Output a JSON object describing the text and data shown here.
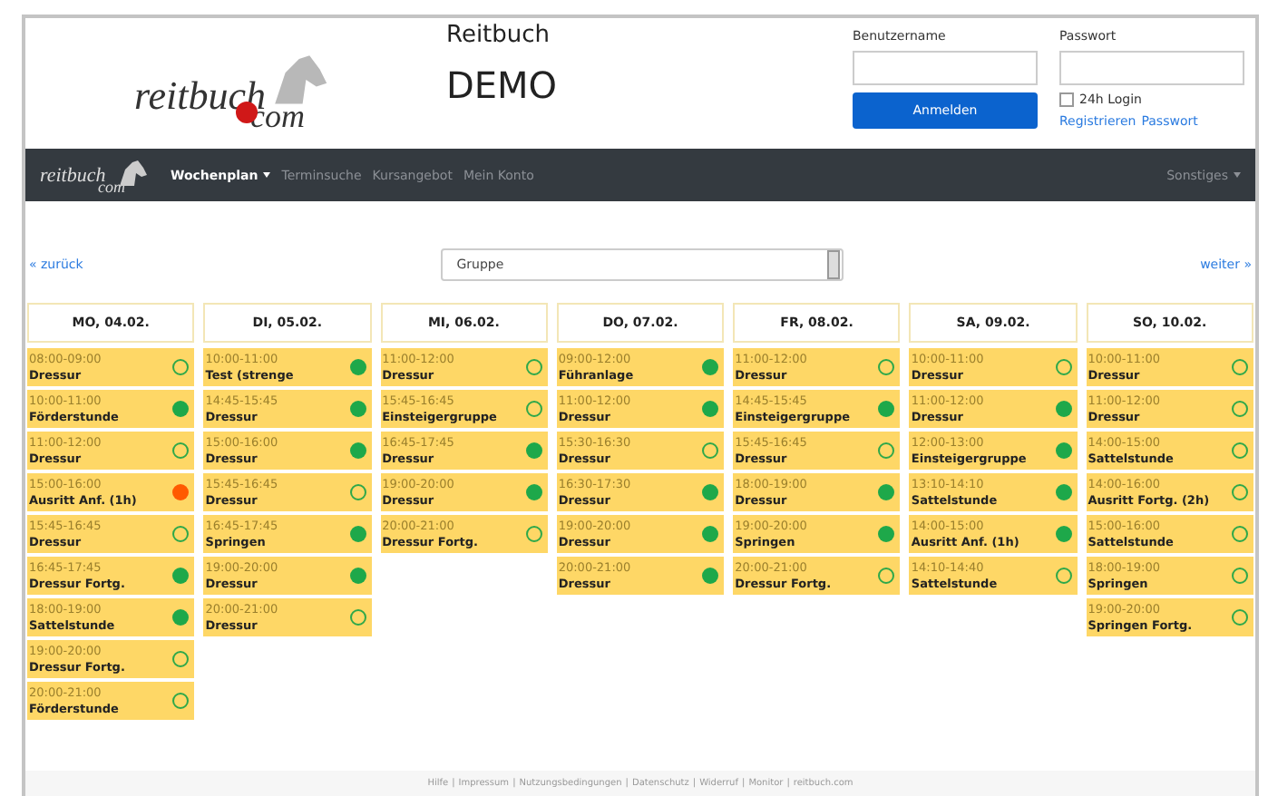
{
  "header": {
    "logo_text": "reitbuch",
    "logo_suffix": "com",
    "title": "Reitbuch",
    "subtitle": "DEMO"
  },
  "login": {
    "username_label": "Benutzername",
    "password_label": "Passwort",
    "submit": "Anmelden",
    "remember": {
      "label": "24h Login",
      "checked": false
    },
    "links": [
      "Registrieren",
      "Passwort"
    ]
  },
  "navbar": {
    "logo_text": "reitbuch",
    "logo_suffix": "com",
    "items": [
      {
        "label": "Wochenplan",
        "selected": true,
        "dropdown": true
      },
      {
        "label": "Terminsuche",
        "selected": false,
        "dropdown": false
      },
      {
        "label": "Kursangebot",
        "selected": false,
        "dropdown": false
      },
      {
        "label": "Mein Konto",
        "selected": false,
        "dropdown": false
      }
    ],
    "right_item": {
      "label": "Sonstiges",
      "dropdown": true
    }
  },
  "controls": {
    "back": "« zurück",
    "filter": "Gruppe",
    "next": "weiter »"
  },
  "days": [
    {
      "label": "MO, 04.02.",
      "slots": [
        {
          "time": "08:00-09:00",
          "name": "Dressur",
          "kind": "free"
        },
        {
          "time": "10:00-11:00",
          "name": "Förderstunde",
          "kind": "booked"
        },
        {
          "time": "11:00-12:00",
          "name": "Dressur",
          "kind": "free"
        },
        {
          "time": "15:00-16:00",
          "name": "Ausritt Anf. (1h)",
          "kind": "full"
        },
        {
          "time": "15:45-16:45",
          "name": "Dressur",
          "kind": "free"
        },
        {
          "time": "16:45-17:45",
          "name": "Dressur Fortg.",
          "kind": "booked"
        },
        {
          "time": "18:00-19:00",
          "name": "Sattelstunde",
          "kind": "booked"
        },
        {
          "time": "19:00-20:00",
          "name": "Dressur Fortg.",
          "kind": "free"
        },
        {
          "time": "20:00-21:00",
          "name": "Förderstunde",
          "kind": "free"
        }
      ]
    },
    {
      "label": "DI, 05.02.",
      "slots": [
        {
          "time": "10:00-11:00",
          "name": "Test (strenge",
          "kind": "booked"
        },
        {
          "time": "14:45-15:45",
          "name": "Dressur",
          "kind": "booked"
        },
        {
          "time": "15:00-16:00",
          "name": "Dressur",
          "kind": "booked"
        },
        {
          "time": "15:45-16:45",
          "name": "Dressur",
          "kind": "free"
        },
        {
          "time": "16:45-17:45",
          "name": "Springen",
          "kind": "booked"
        },
        {
          "time": "19:00-20:00",
          "name": "Dressur",
          "kind": "booked"
        },
        {
          "time": "20:00-21:00",
          "name": "Dressur",
          "kind": "free"
        }
      ]
    },
    {
      "label": "MI, 06.02.",
      "slots": [
        {
          "time": "11:00-12:00",
          "name": "Dressur",
          "kind": "free"
        },
        {
          "time": "15:45-16:45",
          "name": "Einsteigergruppe",
          "kind": "free"
        },
        {
          "time": "16:45-17:45",
          "name": "Dressur",
          "kind": "booked"
        },
        {
          "time": "19:00-20:00",
          "name": "Dressur",
          "kind": "booked"
        },
        {
          "time": "20:00-21:00",
          "name": "Dressur Fortg.",
          "kind": "free"
        }
      ]
    },
    {
      "label": "DO, 07.02.",
      "slots": [
        {
          "time": "09:00-12:00",
          "name": "Führanlage",
          "kind": "booked"
        },
        {
          "time": "11:00-12:00",
          "name": "Dressur",
          "kind": "booked"
        },
        {
          "time": "15:30-16:30",
          "name": "Dressur",
          "kind": "free"
        },
        {
          "time": "16:30-17:30",
          "name": "Dressur",
          "kind": "booked"
        },
        {
          "time": "19:00-20:00",
          "name": "Dressur",
          "kind": "booked"
        },
        {
          "time": "20:00-21:00",
          "name": "Dressur",
          "kind": "booked"
        }
      ]
    },
    {
      "label": "FR, 08.02.",
      "slots": [
        {
          "time": "11:00-12:00",
          "name": "Dressur",
          "kind": "free"
        },
        {
          "time": "14:45-15:45",
          "name": "Einsteigergruppe",
          "kind": "booked"
        },
        {
          "time": "15:45-16:45",
          "name": "Dressur",
          "kind": "free"
        },
        {
          "time": "18:00-19:00",
          "name": "Dressur",
          "kind": "booked"
        },
        {
          "time": "19:00-20:00",
          "name": "Springen",
          "kind": "booked"
        },
        {
          "time": "20:00-21:00",
          "name": "Dressur Fortg.",
          "kind": "free"
        }
      ]
    },
    {
      "label": "SA, 09.02.",
      "slots": [
        {
          "time": "10:00-11:00",
          "name": "Dressur",
          "kind": "free"
        },
        {
          "time": "11:00-12:00",
          "name": "Dressur",
          "kind": "booked"
        },
        {
          "time": "12:00-13:00",
          "name": "Einsteigergruppe",
          "kind": "booked"
        },
        {
          "time": "13:10-14:10",
          "name": "Sattelstunde",
          "kind": "booked"
        },
        {
          "time": "14:00-15:00",
          "name": "Ausritt Anf. (1h)",
          "kind": "booked"
        },
        {
          "time": "14:10-14:40",
          "name": "Sattelstunde",
          "kind": "free"
        }
      ]
    },
    {
      "label": "SO, 10.02.",
      "slots": [
        {
          "time": "10:00-11:00",
          "name": "Dressur",
          "kind": "free"
        },
        {
          "time": "11:00-12:00",
          "name": "Dressur",
          "kind": "free"
        },
        {
          "time": "14:00-15:00",
          "name": "Sattelstunde",
          "kind": "free"
        },
        {
          "time": "14:00-16:00",
          "name": "Ausritt Fortg. (2h)",
          "kind": "free"
        },
        {
          "time": "15:00-16:00",
          "name": "Sattelstunde",
          "kind": "free"
        },
        {
          "time": "18:00-19:00",
          "name": "Springen",
          "kind": "free"
        },
        {
          "time": "19:00-20:00",
          "name": "Springen Fortg.",
          "kind": "free"
        }
      ]
    }
  ],
  "footer": {
    "separator": "|",
    "links": [
      "Hilfe",
      "Impressum",
      "Nutzungsbedingungen",
      "Datenschutz",
      "Widerruf",
      "Monitor",
      "reitbuch.com"
    ]
  }
}
